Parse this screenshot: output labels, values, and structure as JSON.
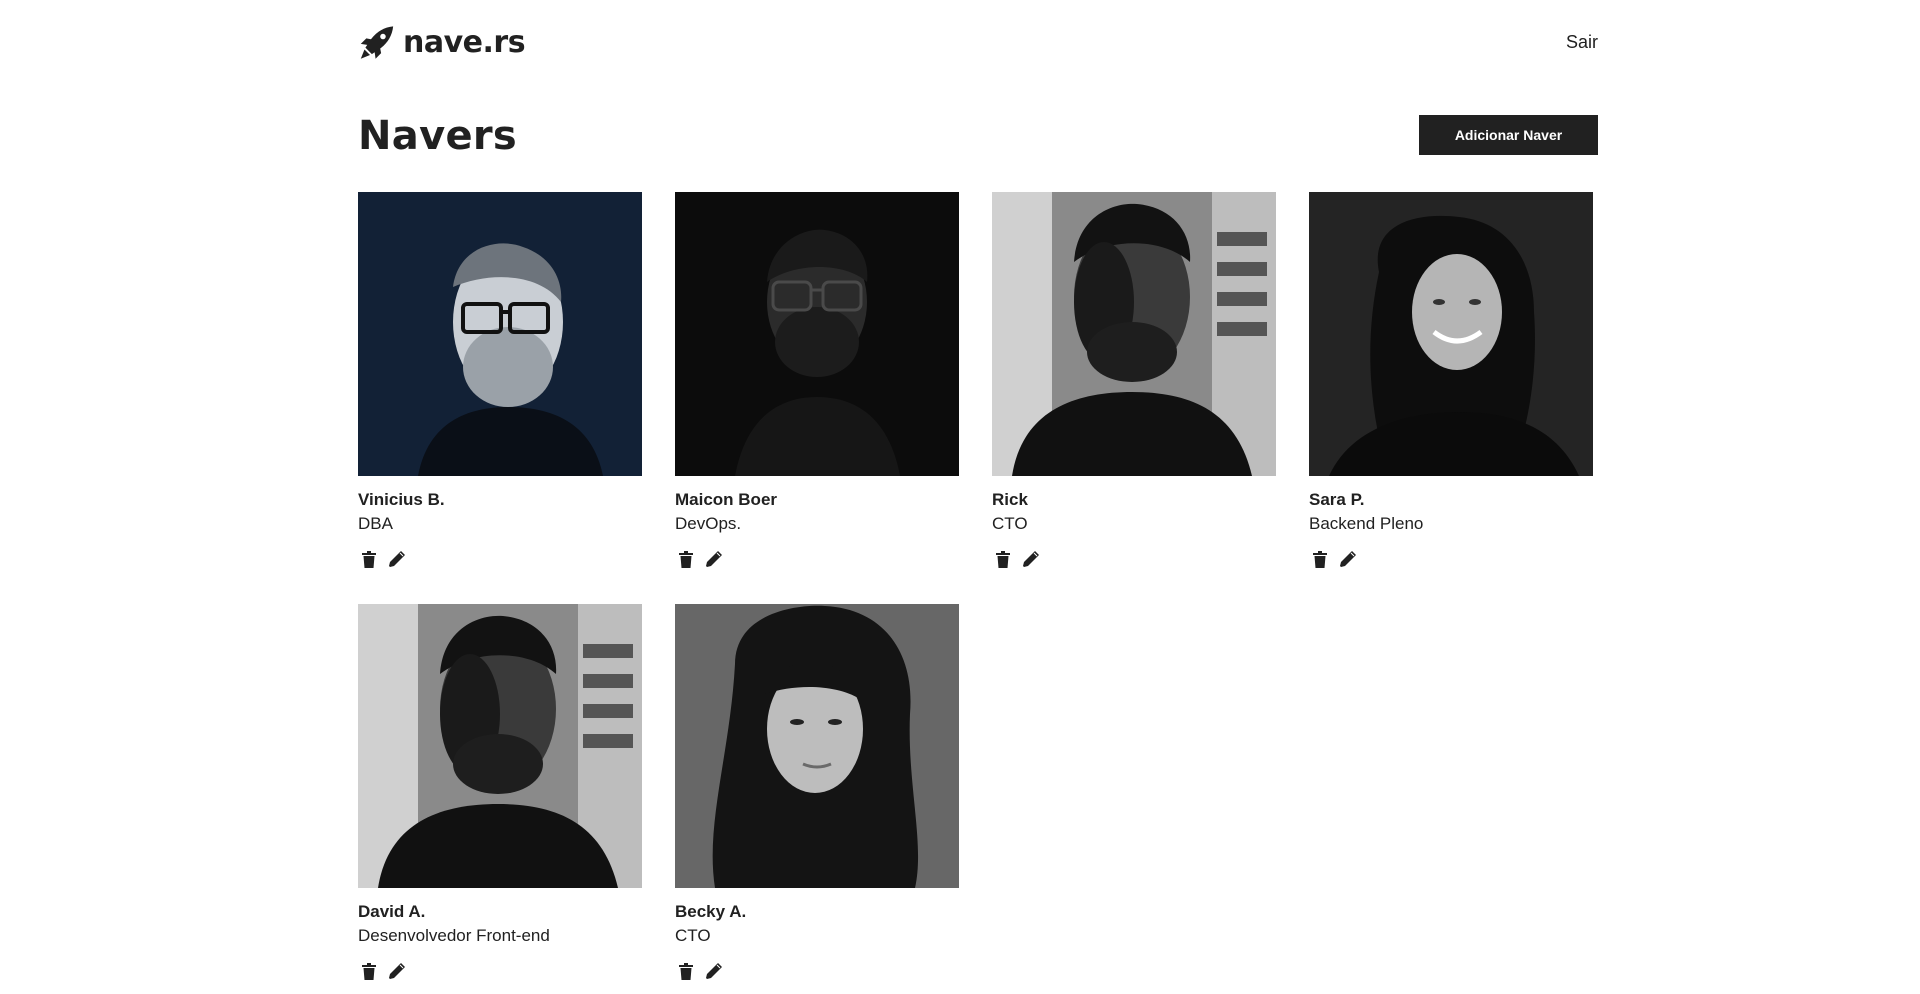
{
  "header": {
    "brand": "nave.rs",
    "logout_label": "Sair"
  },
  "main": {
    "title": "Navers",
    "add_button_label": "Adicionar Naver"
  },
  "navers": [
    {
      "name": "Vinicius B.",
      "role": "DBA",
      "photo": "portrait-man-glasses-beard-blue"
    },
    {
      "name": "Maicon Boer",
      "role": "DevOps.",
      "photo": "portrait-man-glasses-dark"
    },
    {
      "name": "Rick",
      "role": "CTO",
      "photo": "portrait-man-turtleneck"
    },
    {
      "name": "Sara P.",
      "role": "Backend Pleno",
      "photo": "portrait-woman-curly-hair-smiling"
    },
    {
      "name": "David A.",
      "role": "Desenvolvedor Front-end",
      "photo": "portrait-man-turtleneck"
    },
    {
      "name": "Becky A.",
      "role": "CTO",
      "photo": "portrait-woman-long-hair"
    }
  ],
  "icons": {
    "logo": "rocket-icon",
    "delete": "trash-icon",
    "edit": "pencil-icon"
  },
  "colors": {
    "text": "#212121",
    "button_bg": "#212121",
    "button_text": "#ffffff",
    "background": "#ffffff"
  }
}
